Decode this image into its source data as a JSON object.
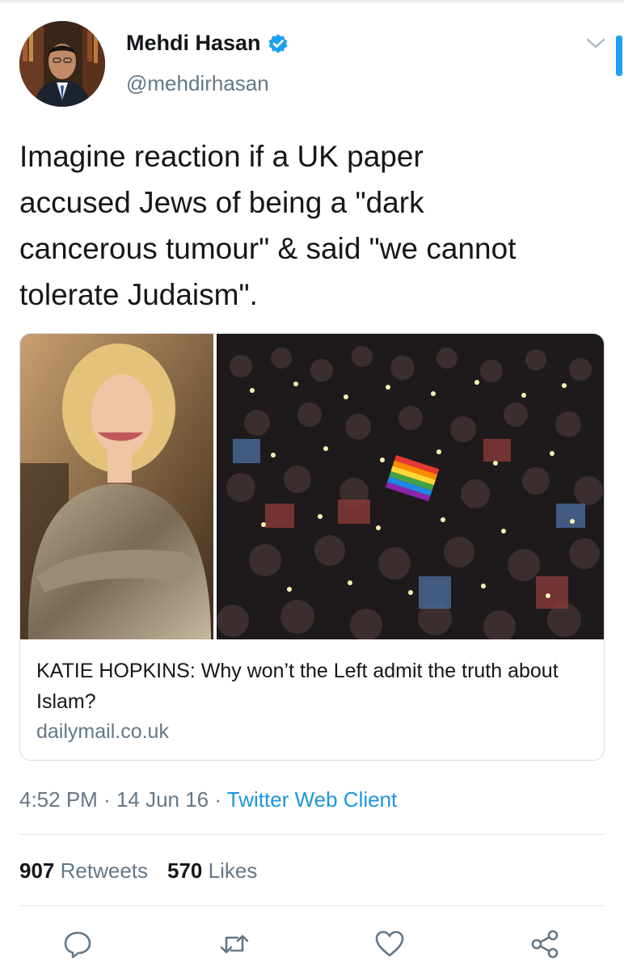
{
  "user": {
    "name": "Mehdi Hasan",
    "handle": "@mehdirhasan",
    "verified": true
  },
  "tweet": {
    "text": "Imagine reaction if a UK paper\naccused Jews of being a \"dark\ncancerous tumour\" & said \"we cannot\ntolerate Judaism\"."
  },
  "card": {
    "title": "KATIE HOPKINS: Why won’t the Left admit the truth about Islam?",
    "domain": "dailymail.co.uk"
  },
  "meta": {
    "time": "4:52 PM",
    "separator": " · ",
    "date": "14 Jun 16",
    "client": "Twitter Web Client"
  },
  "stats": {
    "retweets_count": "907",
    "retweets_label": "Retweets",
    "likes_count": "570",
    "likes_label": "Likes"
  },
  "actions": [
    "reply-icon",
    "retweet-icon",
    "like-icon",
    "share-icon"
  ],
  "colors": {
    "accent": "#1da1f2",
    "link": "#1b95e0",
    "secondary_text": "#657786",
    "primary_text": "#14171a",
    "border": "#e1e8ed"
  }
}
